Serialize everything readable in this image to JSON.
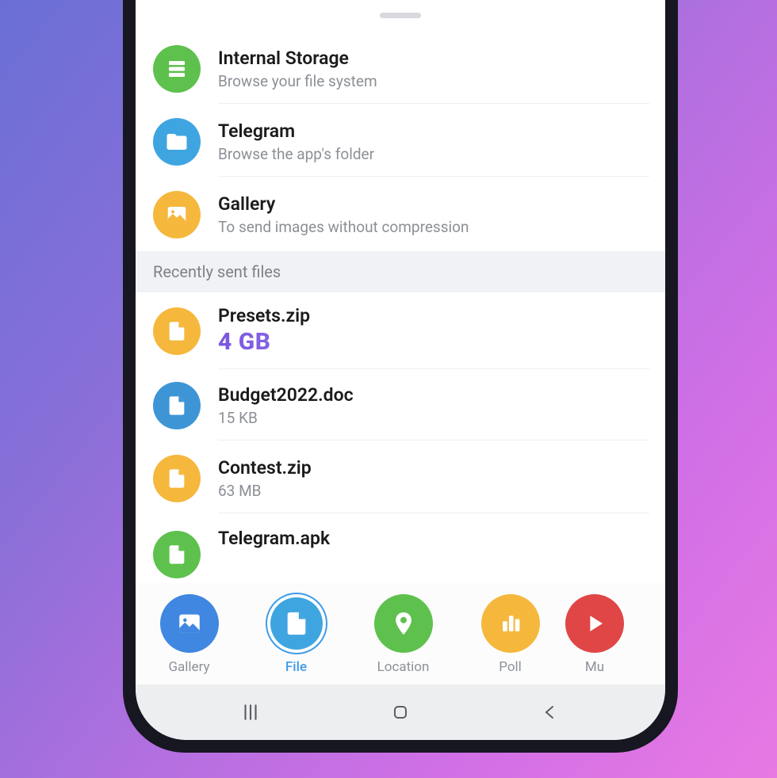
{
  "colors": {
    "green": "#5ec14d",
    "blue": "#3fa5e0",
    "yellow": "#f5b83d",
    "bluefile": "#3e95d6",
    "purpleb": "#3f87e0",
    "red": "#e04646"
  },
  "sources": [
    {
      "icon": "storage-icon",
      "color": "green",
      "title": "Internal Storage",
      "subtitle": "Browse your file system"
    },
    {
      "icon": "folder-icon",
      "color": "blue",
      "title": "Telegram",
      "subtitle": "Browse the app's folder"
    },
    {
      "icon": "image-icon",
      "color": "yellow",
      "title": "Gallery",
      "subtitle": "To send images without compression"
    }
  ],
  "section_header": "Recently sent files",
  "recent": [
    {
      "icon": "file-icon",
      "color": "yellow",
      "title": "Presets.zip",
      "subtitle": "4 GB",
      "highlight": true
    },
    {
      "icon": "file-icon",
      "color": "bluefile",
      "title": "Budget2022.doc",
      "subtitle": "15 KB",
      "highlight": false
    },
    {
      "icon": "file-icon",
      "color": "yellow",
      "title": "Contest.zip",
      "subtitle": "63 MB",
      "highlight": false
    },
    {
      "icon": "file-icon",
      "color": "green",
      "title": "Telegram.apk",
      "subtitle": "",
      "highlight": false
    }
  ],
  "tabs": [
    {
      "id": "gallery",
      "label": "Gallery",
      "icon": "image-icon",
      "color": "purpleb",
      "active": false
    },
    {
      "id": "file",
      "label": "File",
      "icon": "file-icon",
      "color": "blue",
      "active": true
    },
    {
      "id": "location",
      "label": "Location",
      "icon": "pin-icon",
      "color": "green",
      "active": false
    },
    {
      "id": "poll",
      "label": "Poll",
      "icon": "poll-icon",
      "color": "yellow",
      "active": false
    },
    {
      "id": "music",
      "label": "Mu",
      "icon": "play-icon",
      "color": "red",
      "active": false
    }
  ]
}
